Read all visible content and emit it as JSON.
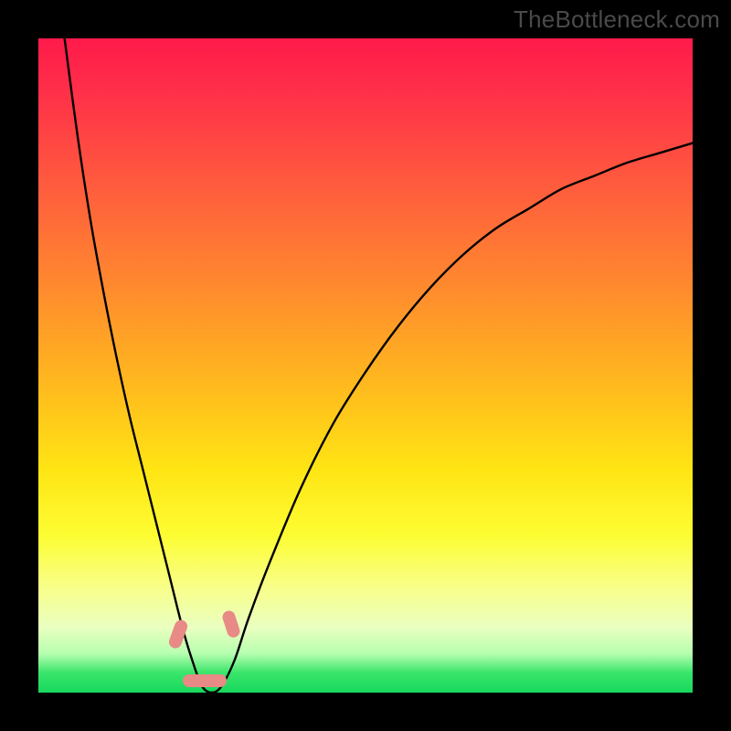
{
  "watermark": "TheBottleneck.com",
  "chart_data": {
    "type": "line",
    "title": "",
    "xlabel": "",
    "ylabel": "",
    "xlim": [
      0,
      100
    ],
    "ylim": [
      0,
      100
    ],
    "grid": false,
    "series": [
      {
        "name": "bottleneck-curve",
        "x": [
          4,
          6,
          8,
          10,
          12,
          14,
          16,
          18,
          20,
          22,
          23.5,
          25,
          26.5,
          28,
          30,
          32,
          35,
          40,
          45,
          50,
          55,
          60,
          65,
          70,
          75,
          80,
          85,
          90,
          95,
          100
        ],
        "values": [
          100,
          85,
          72,
          61,
          51,
          42,
          34,
          26,
          18,
          10,
          5,
          1,
          0,
          1,
          5,
          11,
          19,
          31,
          41,
          49,
          56,
          62,
          67,
          71,
          74,
          77,
          79,
          81,
          82.5,
          84
        ]
      }
    ],
    "annotations": [
      {
        "name": "marker-left",
        "shape": "pill-diag",
        "x": 22.5,
        "y": 6.5
      },
      {
        "name": "marker-right",
        "shape": "pill-diag",
        "x": 30.5,
        "y": 8.0
      },
      {
        "name": "marker-bottom",
        "shape": "pill-horz",
        "x": 26.0,
        "y": 0.5
      }
    ]
  },
  "colors": {
    "curve": "#000000",
    "marker": "#e88a86",
    "frame": "#000000"
  }
}
